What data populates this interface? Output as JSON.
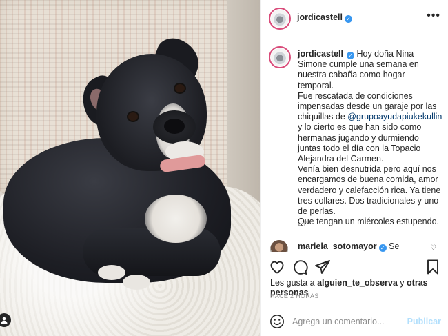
{
  "post": {
    "image_alt": "Black puppy with white chest and pink collar lying on a white blanket",
    "header_username": "jordicastell",
    "caption": {
      "username": "jordicastell",
      "line1": "Hoy doña Nina Simone cumple una semana en nuestra cabaña como hogar temporal.",
      "line2_before": "Fue rescatada de condiciones impensadas desde un garaje por las chiquillas de ",
      "mention": "@grupoayudapiukekullin",
      "line2_after": " y lo cierto es que han sido como hermanas jugando y durmiendo juntas todo el día con la Topacio Alejandra del Carmen.",
      "line3": "Venía bien desnutrida pero aquí nos encargamos de buena comida, amor verdadero y calefacción rica. Ya tiene tres collares. Dos tradicionales y uno de perlas.",
      "line4": "Que tengan un miércoles estupendo."
    },
    "caption_time": "2 h",
    "comment": {
      "username": "mariela_sotomayor",
      "text": "Se"
    },
    "likes": {
      "prefix": "Les gusta a ",
      "user": "alguien_te_observa",
      "middle": " y ",
      "others": "otras personas"
    },
    "timestamp": "HACE 2 HORAS",
    "comment_box": {
      "placeholder": "Agrega un comentario...",
      "publish_label": "Publicar"
    },
    "icons": {
      "verified": "verified-badge-icon",
      "more": "more-options-icon",
      "like": "heart-icon",
      "comment": "comment-icon",
      "share": "share-icon",
      "save": "bookmark-icon",
      "emoji": "emoji-icon",
      "tag": "user-tag-icon"
    },
    "colors": {
      "verified": "#3897f0",
      "mention": "#00376b",
      "publish_disabled": "#b2dffc",
      "muted_text": "#8e8e8e"
    }
  }
}
